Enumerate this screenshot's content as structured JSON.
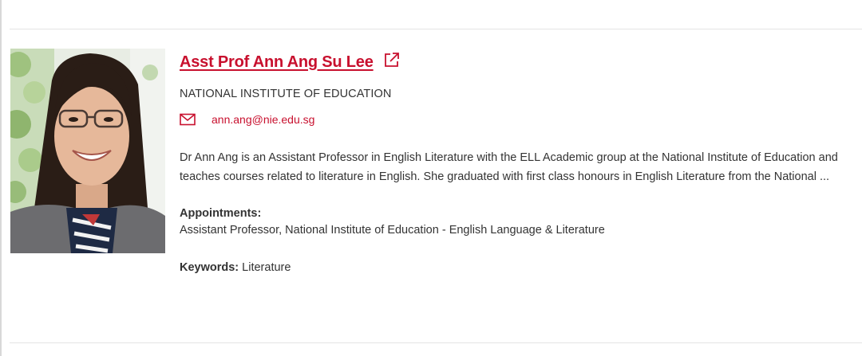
{
  "profile": {
    "name": "Asst Prof Ann Ang Su Lee",
    "institute": "NATIONAL INSTITUTE OF EDUCATION",
    "email": "ann.ang@nie.edu.sg",
    "bio": "Dr Ann Ang is an Assistant Professor in English Literature with the ELL Academic group at the National Institute of Education and teaches courses related to literature in English. She graduated with first class honours in English Literature from the National ...",
    "appointments_label": "Appointments:",
    "appointments_value": "Assistant Professor, National Institute of Education - English Language & Literature",
    "keywords_label": "Keywords:",
    "keywords_value": "Literature"
  },
  "icons": {
    "external_link": "external-link-icon",
    "mail": "mail-icon"
  },
  "colors": {
    "accent": "#c8102e",
    "text": "#333333",
    "divider": "#e3e3e3"
  }
}
